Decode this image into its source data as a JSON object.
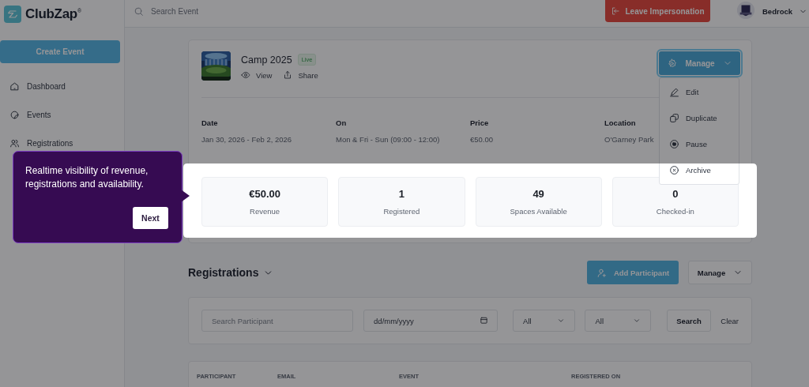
{
  "brand": {
    "name": "ClubZap",
    "mark": "®"
  },
  "sidebar": {
    "create_button": "Create Event",
    "items": [
      {
        "label": "Dashboard"
      },
      {
        "label": "Events"
      },
      {
        "label": "Registrations"
      }
    ]
  },
  "topbar": {
    "search_placeholder": "Search Event",
    "leave_button": "Leave Impersonation",
    "user": "Bedrock"
  },
  "event": {
    "title": "Camp 2025",
    "status": "Live",
    "actions": [
      "View",
      "Share"
    ],
    "manage": {
      "label": "Manage",
      "expanded": true
    },
    "details": [
      {
        "label": "Date",
        "value": "Jan 30, 2026 - Feb 2, 2026"
      },
      {
        "label": "On",
        "value": "Mon & Fri - Sun (09:00 - 12:00)"
      },
      {
        "label": "Price",
        "value": "€50.00"
      },
      {
        "label": "Location",
        "value": "O'Garney Park"
      }
    ],
    "manage_menu": [
      {
        "label": "Edit"
      },
      {
        "label": "Duplicate"
      },
      {
        "label": "Pause"
      },
      {
        "label": "Archive"
      }
    ],
    "stats": [
      {
        "value": "€50.00",
        "label": "Revenue"
      },
      {
        "value": "1",
        "label": "Registered"
      },
      {
        "value": "49",
        "label": "Spaces Available"
      },
      {
        "value": "0",
        "label": "Checked-in"
      }
    ]
  },
  "tour": {
    "text": "Realtime visibility of revenue, registrations and availability.",
    "button": "Next"
  },
  "registrations": {
    "title": "Registrations",
    "add_button": "Add Participant",
    "manage_button": "Manage",
    "filters": {
      "search_placeholder": "Search Participant",
      "date_placeholder": "dd/mm/yyyy",
      "selects": [
        "All",
        "All"
      ],
      "search_button": "Search",
      "clear_button": "Clear"
    },
    "columns": [
      "PARTICIPANT",
      "EMAIL",
      "EVENT",
      "REGISTERED ON"
    ]
  }
}
